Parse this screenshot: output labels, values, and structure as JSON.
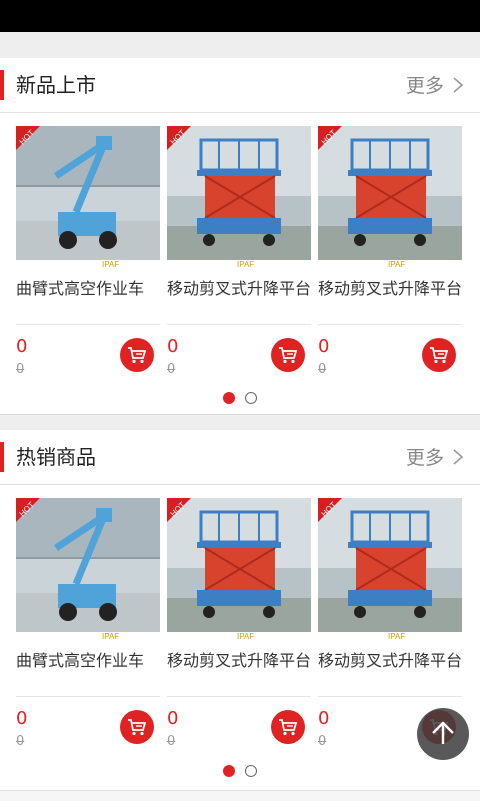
{
  "colors": {
    "accent": "#e02222",
    "gray_bg": "#eeeeee"
  },
  "sections": [
    {
      "title": "新品上市",
      "more": "更多",
      "products": [
        {
          "name": "曲臂式高空作业车",
          "price": "0",
          "old_price": "0",
          "image": "articulating-boom-lift",
          "badge": "HOT"
        },
        {
          "name": "移动剪叉式升降平台",
          "price": "0",
          "old_price": "0",
          "image": "scissor-lift",
          "badge": "HOT"
        },
        {
          "name": "移动剪叉式升降平台",
          "price": "0",
          "old_price": "0",
          "image": "scissor-lift",
          "badge": "HOT"
        }
      ],
      "pager": {
        "pages": 2,
        "current": 1
      }
    },
    {
      "title": "热销商品",
      "more": "更多",
      "products": [
        {
          "name": "曲臂式高空作业车",
          "price": "0",
          "old_price": "0",
          "image": "articulating-boom-lift",
          "badge": "HOT"
        },
        {
          "name": "移动剪叉式升降平台",
          "price": "0",
          "old_price": "0",
          "image": "scissor-lift",
          "badge": "HOT"
        },
        {
          "name": "移动剪叉式升降平台",
          "price": "0",
          "old_price": "0",
          "image": "scissor-lift",
          "badge": "HOT"
        }
      ],
      "pager": {
        "pages": 2,
        "current": 1
      }
    }
  ],
  "fab": {
    "icon": "arrow-up-icon"
  },
  "cart_icon": "cart-icon"
}
